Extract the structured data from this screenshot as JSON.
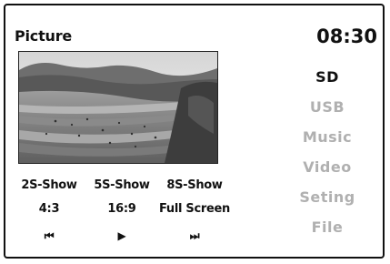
{
  "header": {
    "title": "Picture",
    "clock": "08:30"
  },
  "menu": {
    "items": [
      {
        "label": "SD",
        "active": true
      },
      {
        "label": "USB",
        "active": false
      },
      {
        "label": "Music",
        "active": false
      },
      {
        "label": "Video",
        "active": false
      },
      {
        "label": "Seting",
        "active": false
      },
      {
        "label": "File",
        "active": false
      }
    ]
  },
  "slideshow": {
    "options": [
      "2S-Show",
      "5S-Show",
      "8S-Show"
    ]
  },
  "aspect": {
    "options": [
      "4:3",
      "16:9",
      "Full Screen"
    ]
  },
  "controls": [
    {
      "icon": "previous-icon",
      "glyph": "⏮"
    },
    {
      "icon": "play-icon",
      "glyph": "▶"
    },
    {
      "icon": "next-icon",
      "glyph": "⏭"
    }
  ],
  "colors": {
    "active": "#111111",
    "inactive": "#b0b0b0"
  }
}
